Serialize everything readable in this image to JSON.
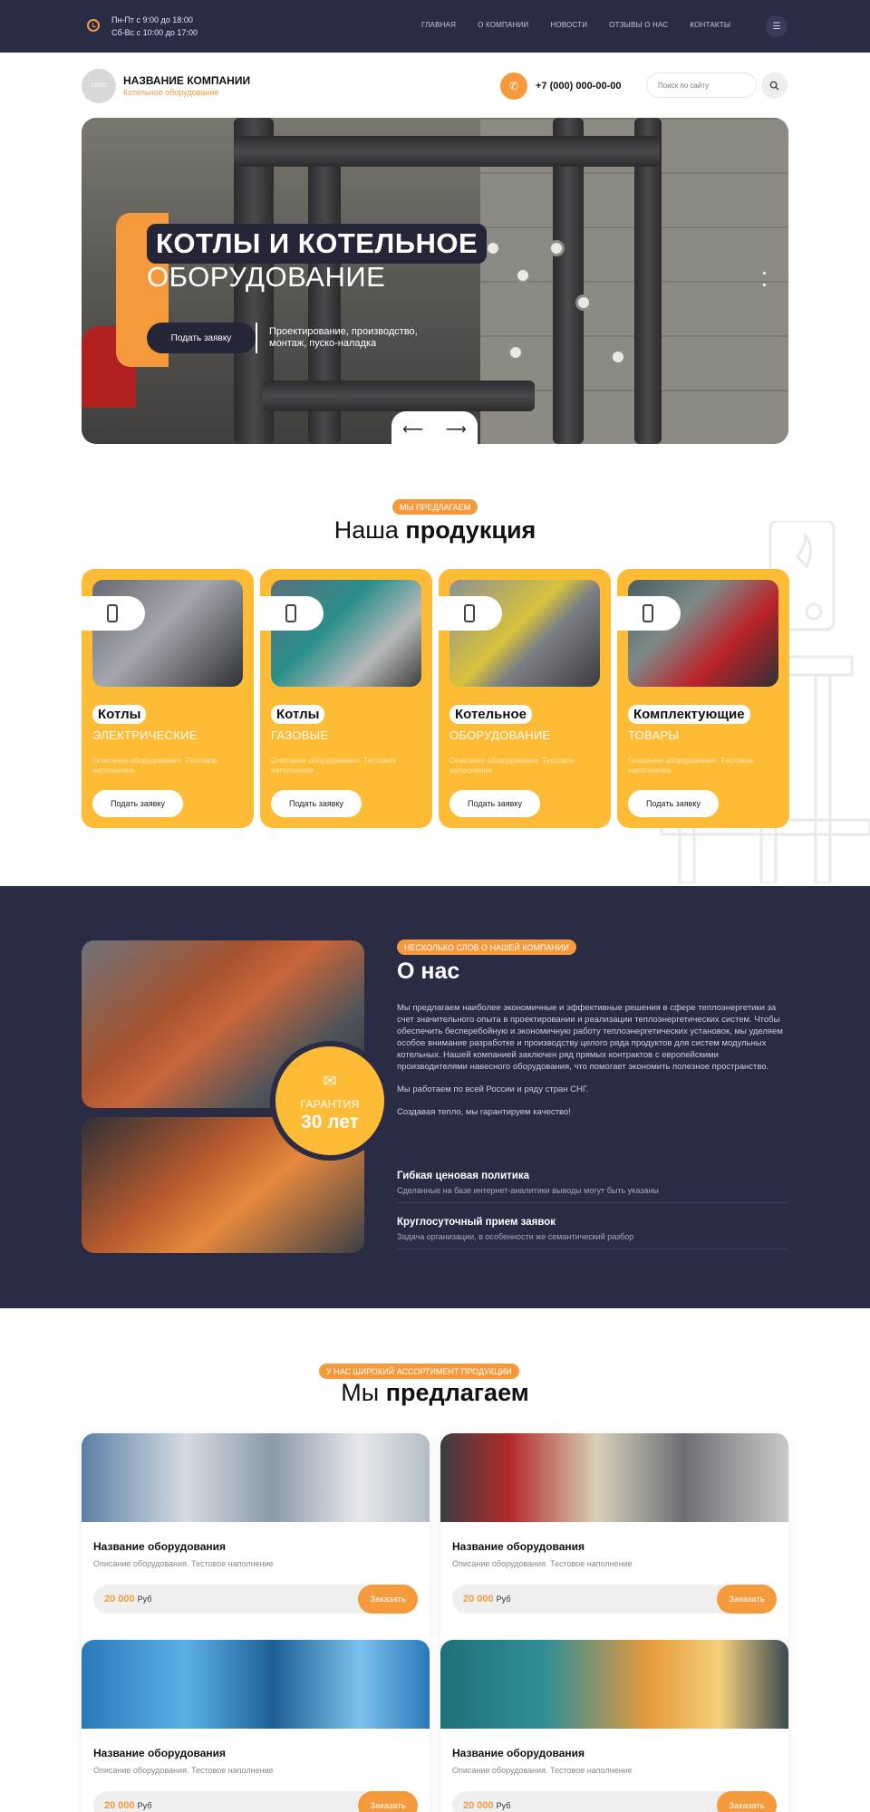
{
  "topbar": {
    "hours_line1": "Пн-Пт с 9:00 до 18:00",
    "hours_line2": "Сб-Вс с 10:00 до 17:00",
    "nav": [
      "ГЛАВНАЯ",
      "О КОМПАНИИ",
      "НОВОСТИ",
      "ОТЗЫВЫ О НАС",
      "КОНТАКТЫ"
    ]
  },
  "header": {
    "logo_text": "LOGO",
    "company_name": "НАЗВАНИЕ КОМПАНИИ",
    "company_sub": "Котельное оборудование",
    "phone": "+7 (000) 000-00-00",
    "search_placeholder": "Поиск по сайту"
  },
  "hero": {
    "title_line1": "КОТЛЫ И КОТЕЛЬНОЕ",
    "title_line2": "ОБОРУДОВАНИЕ",
    "button": "Подать заявку",
    "subtitle": "Проектирование, производство, монтаж, пуско-наладка",
    "prev": "⟵",
    "next": "⟶"
  },
  "products": {
    "badge": "МЫ ПРЕДЛАГАЕМ",
    "title_light": "Наша ",
    "title_bold": "продукция",
    "cards": [
      {
        "title": "Котлы",
        "sub": "ЭЛЕКТРИЧЕСКИЕ",
        "desc": "Описание оборудования. Тестовое наполнение",
        "button": "Подать заявку"
      },
      {
        "title": "Котлы",
        "sub": "ГАЗОВЫЕ",
        "desc": "Описание оборудования. Тестовое наполнение",
        "button": "Подать заявку"
      },
      {
        "title": "Котельное",
        "sub": "ОБОРУДОВАНИЕ",
        "desc": "Описание оборудования. Тестовое наполнение",
        "button": "Подать заявку"
      },
      {
        "title": "Комплектующие",
        "sub": "ТОВАРЫ",
        "desc": "Описание оборудования. Тестовое наполнение",
        "button": "Подать заявку"
      }
    ]
  },
  "about": {
    "badge": "НЕСКОЛЬКО СЛОВ О НАШЕЙ КОМПАНИИ",
    "title": "О нас",
    "paragraph1": "Мы предлагаем наиболее экономичные и эффективные решения в сфере теплоэнергетики за счет значительного опыта в проектировании и реализации теплоэнергетических систем. Чтобы обеспечить бесперебойную и экономичную работу теплоэнергетических установок, мы уделяем особое внимание разработке и производству целого ряда продуктов для систем модульных котельных. Нашей компанией заключен ряд прямых контрактов с европейскими производителями навесного оборудования, что помогает экономить полезное пространство.",
    "paragraph2": "Мы работаем по всей России и ряду стран СНГ.",
    "paragraph3": "Создавая тепло, мы гарантируем качество!",
    "guarantee_label": "ГАРАНТИЯ",
    "guarantee_value": "30 лет",
    "features": [
      {
        "title": "Гибкая ценовая политика",
        "desc": "Сделанные на базе интернет-аналитики выводы могут быть указаны"
      },
      {
        "title": "Круглосуточный прием заявок",
        "desc": "Задача организации, в особенности же семантический разбор"
      }
    ]
  },
  "offers": {
    "badge": "У НАС ШИРОКИЙ АССОРТИМЕНТ ПРОДУКЦИИ",
    "title_light": "Мы ",
    "title_bold": "предлагаем",
    "items": [
      {
        "title": "Название оборудования",
        "desc": "Описание оборудования. Тестовое наполнение",
        "price": "20 000",
        "currency": "Руб",
        "button": "Заказать"
      },
      {
        "title": "Название оборудования",
        "desc": "Описание оборудования. Тестовое наполнение",
        "price": "20 000",
        "currency": "Руб",
        "button": "Заказать"
      },
      {
        "title": "Название оборудования",
        "desc": "Описание оборудования. Тестовое наполнение",
        "price": "20 000",
        "currency": "Руб",
        "button": "Заказать"
      },
      {
        "title": "Название оборудования",
        "desc": "Описание оборудования. Тестовое наполнение",
        "price": "20 000",
        "currency": "Руб",
        "button": "Заказать"
      }
    ]
  },
  "colors": {
    "accent": "#f59a3c",
    "yellow": "#fdbb36",
    "dark": "#2a2b45"
  }
}
